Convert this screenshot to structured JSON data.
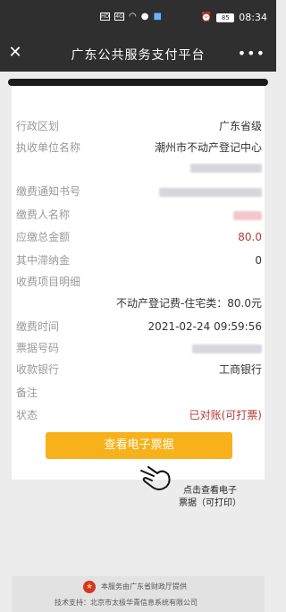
{
  "status_bar": {
    "time": "08:34",
    "battery": "85",
    "network": "HD",
    "signal": "4G"
  },
  "nav": {
    "title": "广东公共服务支付平台",
    "close_icon": "close-icon",
    "more_icon": "more-icon"
  },
  "fields": [
    {
      "label": "行政区划",
      "value": "广东省级"
    },
    {
      "label": "执收单位名称",
      "value": "潮州市不动产登记中心"
    },
    {
      "label": "缴费通知书号",
      "value": ""
    },
    {
      "label": "缴费人名称",
      "value": ""
    },
    {
      "label": "应缴总金额",
      "value": "80.0"
    },
    {
      "label": "其中滞纳金",
      "value": "0"
    },
    {
      "label": "收费项目明细",
      "value": ""
    },
    {
      "label": "缴费时间",
      "value": "2021-02-24 09:59:56"
    },
    {
      "label": "票据号码",
      "value": ""
    },
    {
      "label": "收款银行",
      "value": "工商银行"
    },
    {
      "label": "备注",
      "value": ""
    },
    {
      "label": "状态",
      "value": "已对账(可打票)"
    }
  ],
  "detail_item": "不动产登记费-住宅类：80.0元",
  "button": {
    "label": "查看电子票据"
  },
  "hint": {
    "line1": "点击查看电子",
    "line2": "票据（可打印）"
  },
  "footer": {
    "line1": "本服务由广东省财政厅提供",
    "line2": "技术支持：北京市太极华青信息系统有限公司"
  },
  "colors": {
    "accent": "#f7b21b",
    "amount": "#b23a3a",
    "nav_bg": "#2f2f2f"
  }
}
